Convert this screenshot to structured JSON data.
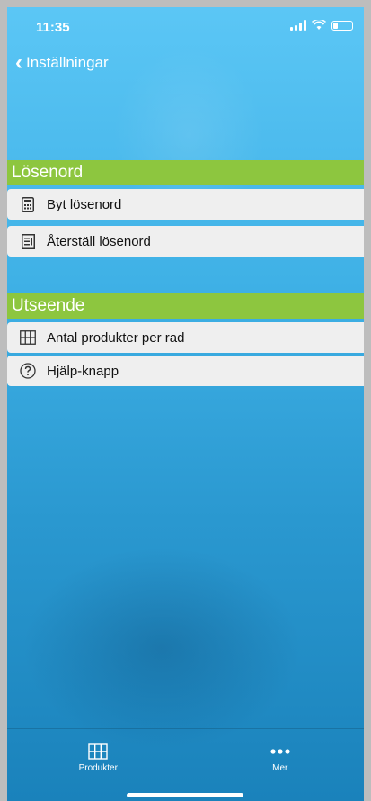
{
  "status": {
    "time": "11:35"
  },
  "nav": {
    "back_label": "Inställningar"
  },
  "sections": [
    {
      "title": "Lösenord",
      "items": [
        {
          "label": "Byt lösenord",
          "icon": "calculator-icon"
        },
        {
          "label": "Återställ lösenord",
          "icon": "document-icon"
        }
      ]
    },
    {
      "title": "Utseende",
      "items": [
        {
          "label": "Antal produkter per rad",
          "icon": "grid-icon"
        },
        {
          "label": "Hjälp-knapp",
          "icon": "help-circle-icon"
        }
      ]
    }
  ],
  "tabbar": [
    {
      "label": "Produkter",
      "icon": "grid-icon"
    },
    {
      "label": "Mer",
      "icon": "more-icon"
    }
  ],
  "colors": {
    "accent": "#8dc63f",
    "background": "#2a98d0",
    "row": "#efefef"
  }
}
